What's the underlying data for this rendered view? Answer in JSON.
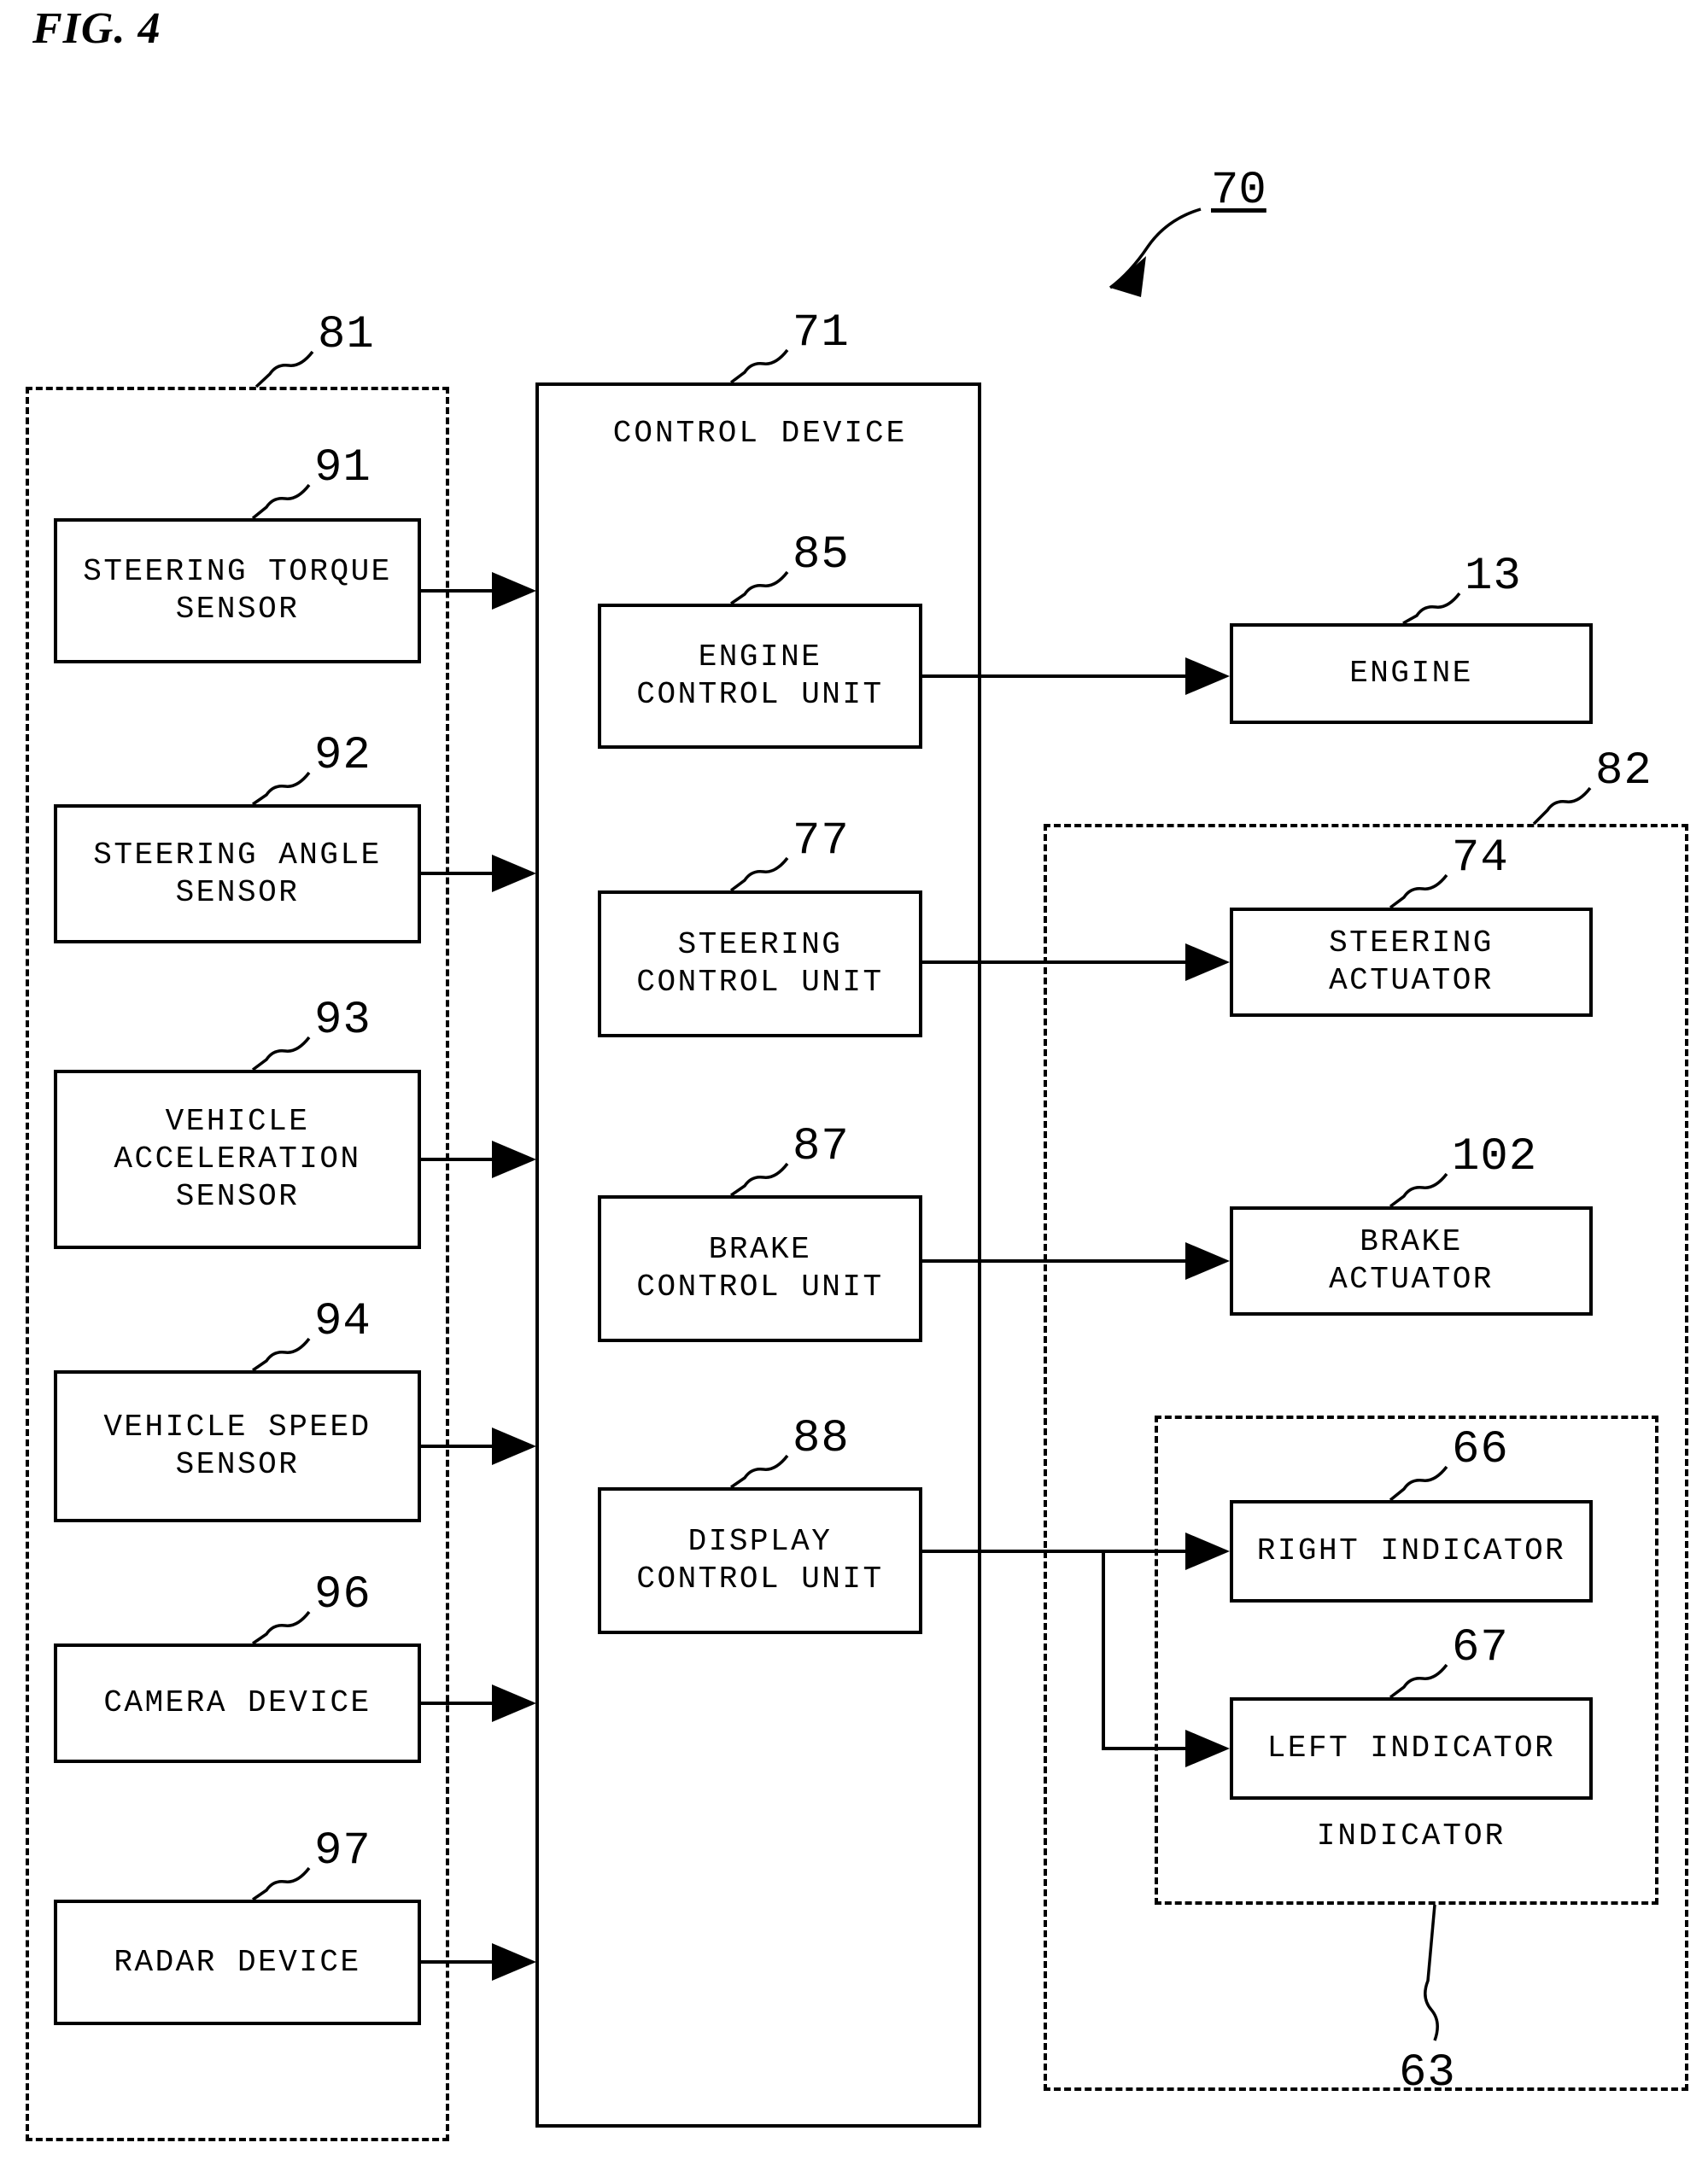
{
  "figure": {
    "title": "FIG. 4",
    "system_ref": "70"
  },
  "sensor_group": {
    "ref": "81",
    "items": [
      {
        "ref": "91",
        "label": "STEERING TORQUE\nSENSOR",
        "line1": "STEERING TORQUE",
        "line2": "SENSOR"
      },
      {
        "ref": "92",
        "label": "STEERING ANGLE\nSENSOR",
        "line1": "STEERING ANGLE",
        "line2": "SENSOR"
      },
      {
        "ref": "93",
        "label": "VEHICLE\nACCELERATION\nSENSOR",
        "line1": "VEHICLE",
        "line2": "ACCELERATION",
        "line3": "SENSOR"
      },
      {
        "ref": "94",
        "label": "VEHICLE SPEED\nSENSOR",
        "line1": "VEHICLE SPEED",
        "line2": "SENSOR"
      },
      {
        "ref": "96",
        "label": "CAMERA DEVICE",
        "line1": "CAMERA DEVICE"
      },
      {
        "ref": "97",
        "label": "RADAR DEVICE",
        "line1": "RADAR DEVICE"
      }
    ]
  },
  "control_device": {
    "ref": "71",
    "title": "CONTROL DEVICE",
    "units": [
      {
        "ref": "85",
        "line1": "ENGINE",
        "line2": "CONTROL UNIT"
      },
      {
        "ref": "77",
        "line1": "STEERING",
        "line2": "CONTROL UNIT"
      },
      {
        "ref": "87",
        "line1": "BRAKE",
        "line2": "CONTROL UNIT"
      },
      {
        "ref": "88",
        "line1": "DISPLAY",
        "line2": "CONTROL UNIT"
      }
    ]
  },
  "engine": {
    "ref": "13",
    "label": "ENGINE"
  },
  "actuator_group": {
    "ref": "82",
    "items": [
      {
        "ref": "74",
        "line1": "STEERING",
        "line2": "ACTUATOR"
      },
      {
        "ref": "102",
        "line1": "BRAKE",
        "line2": "ACTUATOR"
      }
    ]
  },
  "indicator_group": {
    "ref": "63",
    "caption": "INDICATOR",
    "items": [
      {
        "ref": "66",
        "label": "RIGHT INDICATOR"
      },
      {
        "ref": "67",
        "label": "LEFT INDICATOR"
      }
    ]
  },
  "colors": {
    "ink": "#000000",
    "paper": "#ffffff"
  }
}
